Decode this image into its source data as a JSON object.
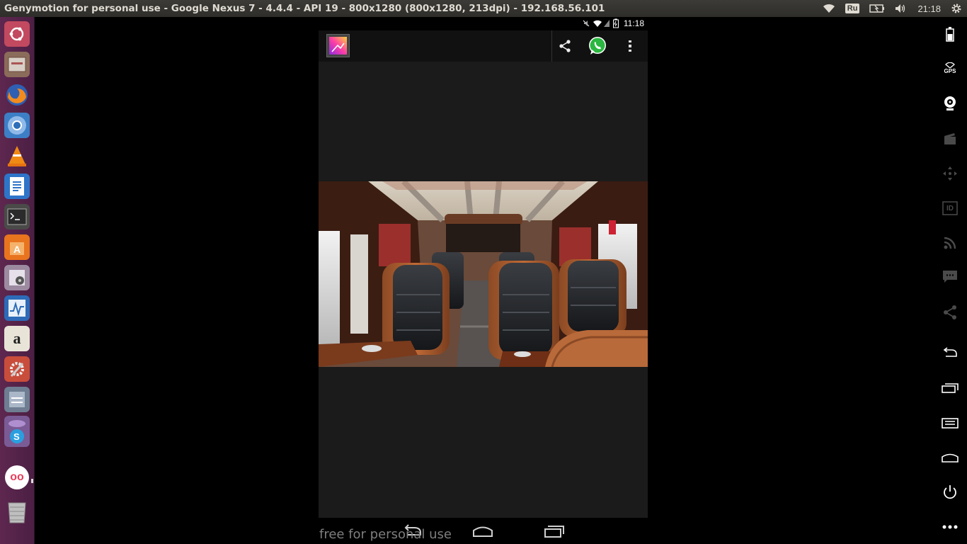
{
  "window": {
    "title": "Genymotion for personal use - Google Nexus 7 - 4.4.4 - API 19 - 800x1280 (800x1280, 213dpi) - 192.168.56.101"
  },
  "panel": {
    "keyboard_layout": "Ru",
    "clock": "21:18"
  },
  "launcher": {
    "items": [
      {
        "name": "ubuntu-dash-icon"
      },
      {
        "name": "files-icon"
      },
      {
        "name": "firefox-icon"
      },
      {
        "name": "chromium-icon"
      },
      {
        "name": "vlc-icon"
      },
      {
        "name": "libreoffice-writer-icon"
      },
      {
        "name": "terminal-icon"
      },
      {
        "name": "software-center-icon"
      },
      {
        "name": "disk-utility-icon"
      },
      {
        "name": "system-monitor-icon"
      },
      {
        "name": "amazon-icon"
      },
      {
        "name": "system-settings-icon"
      },
      {
        "name": "workspaces-icon"
      },
      {
        "name": "app-icon"
      },
      {
        "name": "genymotion-icon"
      },
      {
        "name": "trash-icon"
      }
    ],
    "amazon_letter": "a",
    "genymotion_letters": "oo"
  },
  "android": {
    "status_time": "11:18",
    "actionbar": {
      "share_icon": "share-icon",
      "whatsapp_icon": "whatsapp-icon",
      "overflow_icon": "overflow-menu-icon"
    },
    "watermark": "free for personal use"
  },
  "right_toolbar": [
    {
      "name": "battery-icon"
    },
    {
      "name": "gps-icon",
      "label": "GPS"
    },
    {
      "name": "webcam-icon"
    },
    {
      "name": "screencast-icon"
    },
    {
      "name": "move-icon"
    },
    {
      "name": "device-id-icon",
      "label": "ID"
    },
    {
      "name": "rss-icon"
    },
    {
      "name": "sms-icon"
    },
    {
      "name": "share-icon"
    },
    {
      "name": "back-icon"
    },
    {
      "name": "recent-apps-icon"
    },
    {
      "name": "menu-icon"
    },
    {
      "name": "home-icon"
    },
    {
      "name": "power-icon"
    },
    {
      "name": "more-icon"
    }
  ]
}
